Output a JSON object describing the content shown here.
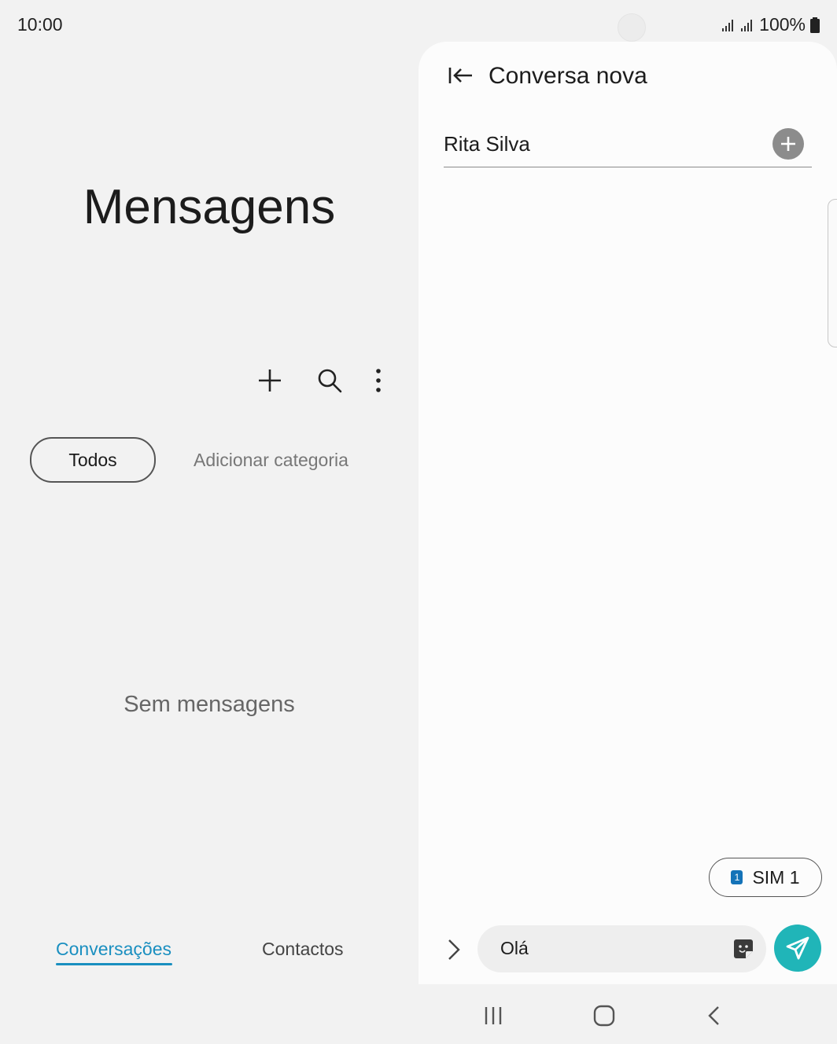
{
  "status_bar": {
    "time": "10:00",
    "battery": "100%"
  },
  "left": {
    "app_title": "Mensagens",
    "empty_text": "Sem mensagens",
    "chips": {
      "all": "Todos",
      "add_category": "Adicionar categoria"
    },
    "tabs": {
      "conversations": "Conversações",
      "contacts": "Contactos"
    },
    "icons": [
      "plus-icon",
      "search-icon",
      "more-options-icon"
    ]
  },
  "right": {
    "title": "Conversa nova",
    "recipient": "Rita Silva",
    "sim": {
      "number": "1",
      "label": "SIM 1"
    },
    "message_input": {
      "value": "Olá"
    },
    "colors": {
      "accent": "#1a8fc0",
      "send": "#20b5b8",
      "sim_badge": "#1473b8"
    }
  }
}
